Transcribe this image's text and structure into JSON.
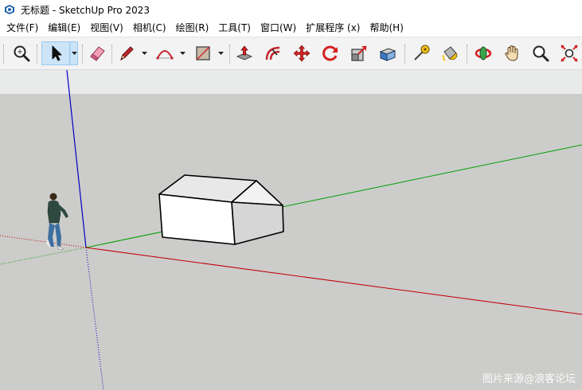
{
  "window": {
    "title": "无标题 - SketchUp Pro 2023",
    "app_icon": "sketchup-logo-icon"
  },
  "menu": [
    {
      "label": "文件(F)"
    },
    {
      "label": "编辑(E)"
    },
    {
      "label": "视图(V)"
    },
    {
      "label": "相机(C)"
    },
    {
      "label": "绘图(R)"
    },
    {
      "label": "工具(T)"
    },
    {
      "label": "窗口(W)"
    },
    {
      "label": "扩展程序 (x)"
    },
    {
      "label": "帮助(H)"
    }
  ],
  "toolbar": {
    "tools": [
      {
        "name": "zoom-extents-tool",
        "icon": "magnifier-icon"
      },
      {
        "name": "select-tool",
        "icon": "arrow-cursor-icon",
        "active": true
      },
      {
        "name": "eraser-tool",
        "icon": "eraser-icon"
      },
      {
        "name": "line-tool",
        "icon": "pencil-icon"
      },
      {
        "name": "arc-tool",
        "icon": "arc-icon"
      },
      {
        "name": "rectangle-tool",
        "icon": "rectangle-icon"
      },
      {
        "name": "push-pull-tool",
        "icon": "push-pull-icon"
      },
      {
        "name": "offset-tool",
        "icon": "offset-icon"
      },
      {
        "name": "move-tool",
        "icon": "move-arrows-icon"
      },
      {
        "name": "rotate-tool",
        "icon": "rotate-icon"
      },
      {
        "name": "scale-tool",
        "icon": "scale-icon"
      },
      {
        "name": "follow-me-tool",
        "icon": "follow-me-icon"
      },
      {
        "name": "tape-measure-tool",
        "icon": "tape-measure-icon"
      },
      {
        "name": "paint-bucket-tool",
        "icon": "paint-bucket-icon"
      },
      {
        "name": "orbit-tool",
        "icon": "orbit-icon"
      },
      {
        "name": "pan-tool",
        "icon": "hand-icon"
      },
      {
        "name": "zoom-tool",
        "icon": "zoom-icon"
      },
      {
        "name": "zoom-window-tool",
        "icon": "zoom-extents-arrows-icon"
      }
    ]
  },
  "scene": {
    "colors": {
      "sky": "#e9eaea",
      "ground": "#cccccb",
      "red_axis": "#c00000",
      "green_axis": "#00a000",
      "blue_axis": "#0000c0"
    },
    "objects": [
      "house-model",
      "person-figure"
    ]
  },
  "watermark": "图片来源@浪客论坛"
}
